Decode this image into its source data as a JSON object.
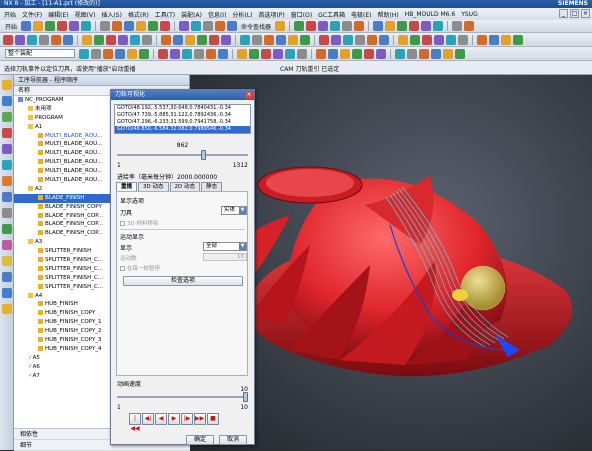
{
  "window": {
    "title": "NX 8 - 加工 - [11-A1.prt (修改的)]",
    "brand": "SIEMENS",
    "controls": [
      "_",
      "□",
      "×"
    ]
  },
  "menubar": {
    "items": [
      "开始",
      "文件(F)",
      "编辑(E)",
      "视图(V)",
      "插入(S)",
      "格式(R)",
      "工具(T)",
      "装配(A)",
      "信息(I)",
      "分析(L)",
      "首选项(P)",
      "窗口(O)",
      "GC工具箱",
      "电极(E)",
      "帮助(H)",
      "HB_MOULD M6.6",
      "YSUG"
    ]
  },
  "toolbar1": {
    "start_label": "开始",
    "labels": [
      "命令查找器"
    ]
  },
  "toolbar3": {
    "filter_label": "整个装配"
  },
  "cueline": {
    "cue": "选择刀轨事件以定位刀具，或使用\"播放\"启动重播",
    "status": "CAM 刀轨重引 已选定"
  },
  "navigator": {
    "title": "工序导航器 - 程序顺序",
    "column_name": "名称",
    "footer": [
      "相依性",
      "细节"
    ],
    "rows": [
      {
        "label": "NC_PROGRAM",
        "depth": 0,
        "type": "root"
      },
      {
        "label": "未用项",
        "depth": 1,
        "type": "folder"
      },
      {
        "label": "PROGRAM",
        "depth": 1,
        "type": "folder"
      },
      {
        "label": "A1",
        "depth": 1,
        "type": "folder"
      },
      {
        "label": "MULTI_BLADE_ROU...",
        "depth": 2,
        "type": "op",
        "blue": true
      },
      {
        "label": "MULTI_BLADE_ROU...",
        "depth": 2,
        "type": "op"
      },
      {
        "label": "MULTI_BLADE_ROU...",
        "depth": 2,
        "type": "op"
      },
      {
        "label": "MULTI_BLADE_ROU...",
        "depth": 2,
        "type": "op"
      },
      {
        "label": "MULTI_BLADE_ROU...",
        "depth": 2,
        "type": "op"
      },
      {
        "label": "MULTI_BLADE_ROU...",
        "depth": 2,
        "type": "op"
      },
      {
        "label": "A2",
        "depth": 1,
        "type": "folder"
      },
      {
        "label": "BLADE_FINISH",
        "depth": 2,
        "type": "op",
        "selected": true
      },
      {
        "label": "BLADE_FINISH_COPY",
        "depth": 2,
        "type": "op"
      },
      {
        "label": "BLADE_FINISH_COP...",
        "depth": 2,
        "type": "op"
      },
      {
        "label": "BLADE_FINISH_COP...",
        "depth": 2,
        "type": "op"
      },
      {
        "label": "BLADE_FINISH_COP...",
        "depth": 2,
        "type": "op"
      },
      {
        "label": "A3",
        "depth": 1,
        "type": "folder"
      },
      {
        "label": "SPLITTER_FINISH",
        "depth": 2,
        "type": "op"
      },
      {
        "label": "SPLITTER_FINISH_C...",
        "depth": 2,
        "type": "op"
      },
      {
        "label": "SPLITTER_FINISH_C...",
        "depth": 2,
        "type": "op"
      },
      {
        "label": "SPLITTER_FINISH_C...",
        "depth": 2,
        "type": "op"
      },
      {
        "label": "SPLITTER_FINISH_C...",
        "depth": 2,
        "type": "op"
      },
      {
        "label": "A4",
        "depth": 1,
        "type": "folder"
      },
      {
        "label": "HUB_FINISH",
        "depth": 2,
        "type": "op"
      },
      {
        "label": "HUB_FINISH_COPY",
        "depth": 2,
        "type": "op"
      },
      {
        "label": "HUB_FINISH_COPY_1",
        "depth": 2,
        "type": "op"
      },
      {
        "label": "HUB_FINISH_COPY_2",
        "depth": 2,
        "type": "op"
      },
      {
        "label": "HUB_FINISH_COPY_3",
        "depth": 2,
        "type": "op"
      },
      {
        "label": "HUB_FINISH_COPY_4",
        "depth": 2,
        "type": "op"
      },
      {
        "label": "A5",
        "depth": 1,
        "type": "folder",
        "check": true
      },
      {
        "label": "A6",
        "depth": 1,
        "type": "folder",
        "check": true
      },
      {
        "label": "A7",
        "depth": 1,
        "type": "folder",
        "check": true
      }
    ]
  },
  "dialog": {
    "title": "刀轨可视化",
    "gotos": [
      "GOTO/48.192,-5.537,30.648,0.7840431,-0.34",
      "GOTO/47.739,-5.885,31.122,0.7892436,-0.34",
      "GOTO/47.296,-6.233,31.599,0.7941758,-0.34",
      "GOTO/46.850,-6.584,32.082,0.7989546,-0.34"
    ],
    "current": "862",
    "min": "1",
    "max": "1312",
    "progress": 0.657,
    "feed": "进给率（毫米每分钟）2000.000000",
    "tabs": [
      "重播",
      "3D 动态",
      "2D 动态",
      "静态"
    ],
    "display_options": "显示选项",
    "tool_label": "刀具",
    "tool_value": "实体",
    "tool_3d": "3D 材料移除",
    "motion_display": "运动显示",
    "show_label": "显示",
    "show_value": "全部",
    "motion_label": "运动数",
    "motion_value": "10",
    "each_step": "在每一帧暂停",
    "check_options": "检查选项",
    "anim_speed": "动画速度",
    "speed_value": "10",
    "speed_min": "1",
    "speed_max": "10",
    "speed": 1.0,
    "playback": [
      "|◀◀",
      "◀|",
      "◀",
      "▶",
      "|▶",
      "▶▶|",
      "■"
    ],
    "ok": "确定",
    "cancel": "取消"
  }
}
